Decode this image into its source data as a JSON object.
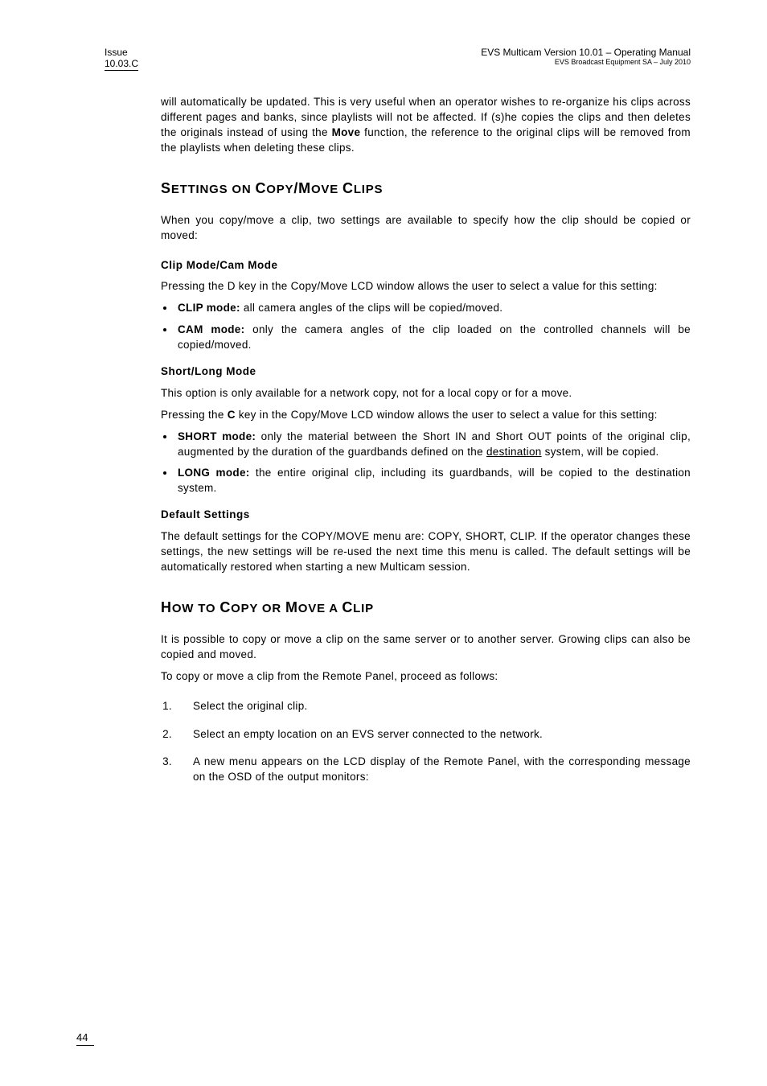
{
  "header": {
    "left_line1": "Issue",
    "left_line2": "10.03.C",
    "right_line1": "EVS Multicam Version 10.01 – Operating Manual",
    "right_line2": "EVS Broadcast Equipment SA – July 2010"
  },
  "intro": {
    "p1a": "will automatically be updated. This is very useful when an operator wishes to re-organize his clips across different pages and banks, since playlists will not be affected. If (s)he copies the clips and then deletes the originals instead of using the ",
    "p1b": "Move",
    "p1c": " function, the reference to the original clips will be removed from the playlists when deleting these clips."
  },
  "section1": {
    "title_parts": [
      "S",
      "ETTINGS ON ",
      "C",
      "OPY",
      "/M",
      "OVE ",
      "C",
      "LIPS"
    ],
    "p1": "When you copy/move a clip, two settings are available to specify how the clip should be copied or moved:",
    "h3a": "Clip Mode/Cam Mode",
    "p2": "Pressing the D key in the Copy/Move LCD window allows the user to select a value for this setting:",
    "li1a": "CLIP mode:",
    "li1b": " all camera angles of the clips will be copied/moved.",
    "li2a": "CAM mode:",
    "li2b": " only the camera angles of the clip loaded on the controlled channels will be copied/moved.",
    "h3b": "Short/Long Mode",
    "p3": "This option is only available for a network copy, not for a local copy or for a move.",
    "p4a": "Pressing the ",
    "p4b": "C",
    "p4c": " key in the Copy/Move LCD window allows the user to select a value for this setting:",
    "li3a": "SHORT mode:",
    "li3b": " only the material between the Short IN and Short OUT points of the original clip, augmented by the duration of the guardbands defined on the ",
    "li3c": "destination",
    "li3d": " system, will be copied.",
    "li4a": "LONG mode:",
    "li4b": " the entire original clip, including its guardbands, will be copied to the destination system.",
    "h3c": "Default Settings",
    "p5": "The default settings for the COPY/MOVE menu are: COPY, SHORT, CLIP. If the operator changes these settings, the new settings will be re-used the next time this menu is called. The default settings will be automatically restored when starting a new Multicam session."
  },
  "section2": {
    "title_parts": [
      "H",
      "OW TO ",
      "C",
      "OPY OR ",
      "M",
      "OVE A ",
      "C",
      "LIP"
    ],
    "p1": "It is possible to copy or move a clip on the same server or to another server. Growing clips can also be copied and moved.",
    "p2": "To copy or move a clip from the Remote Panel, proceed as follows:",
    "li1": "Select the original clip.",
    "li2": "Select an empty location on an EVS server connected to the network.",
    "li3": "A new menu appears on the LCD display of the Remote Panel, with the corresponding message on the OSD of the output monitors:"
  },
  "footer": {
    "page": "44"
  }
}
